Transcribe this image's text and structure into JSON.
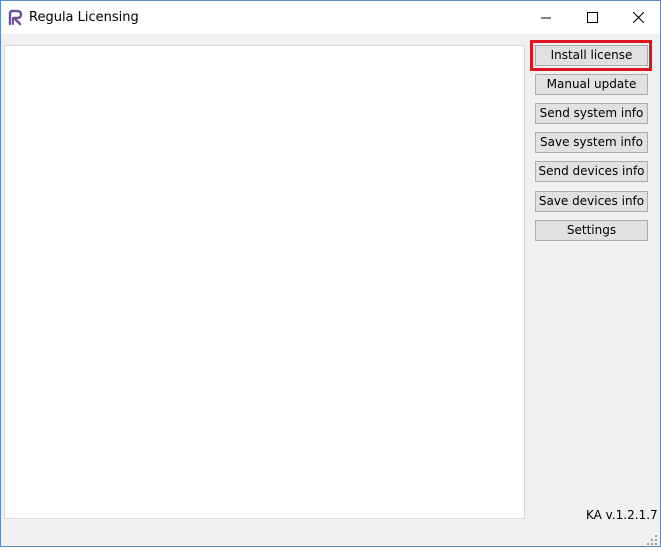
{
  "window": {
    "title": "Regula Licensing",
    "icon": "regula-r-icon"
  },
  "title_buttons": {
    "minimize": "minimize-icon",
    "maximize": "maximize-icon",
    "close": "close-icon"
  },
  "buttons": [
    {
      "label": "Install license",
      "highlighted": true
    },
    {
      "label": "Manual update"
    },
    {
      "label": "Send system info"
    },
    {
      "label": "Save system info"
    },
    {
      "label": "Send devices info"
    },
    {
      "label": "Save devices info"
    },
    {
      "label": "Settings"
    }
  ],
  "version": "KA v.1.2.1.7",
  "colors": {
    "highlight": "#e0141e",
    "window_border": "#5b8cc7",
    "button_bg": "#e1e1e1",
    "logo": "#6b4fa0"
  }
}
